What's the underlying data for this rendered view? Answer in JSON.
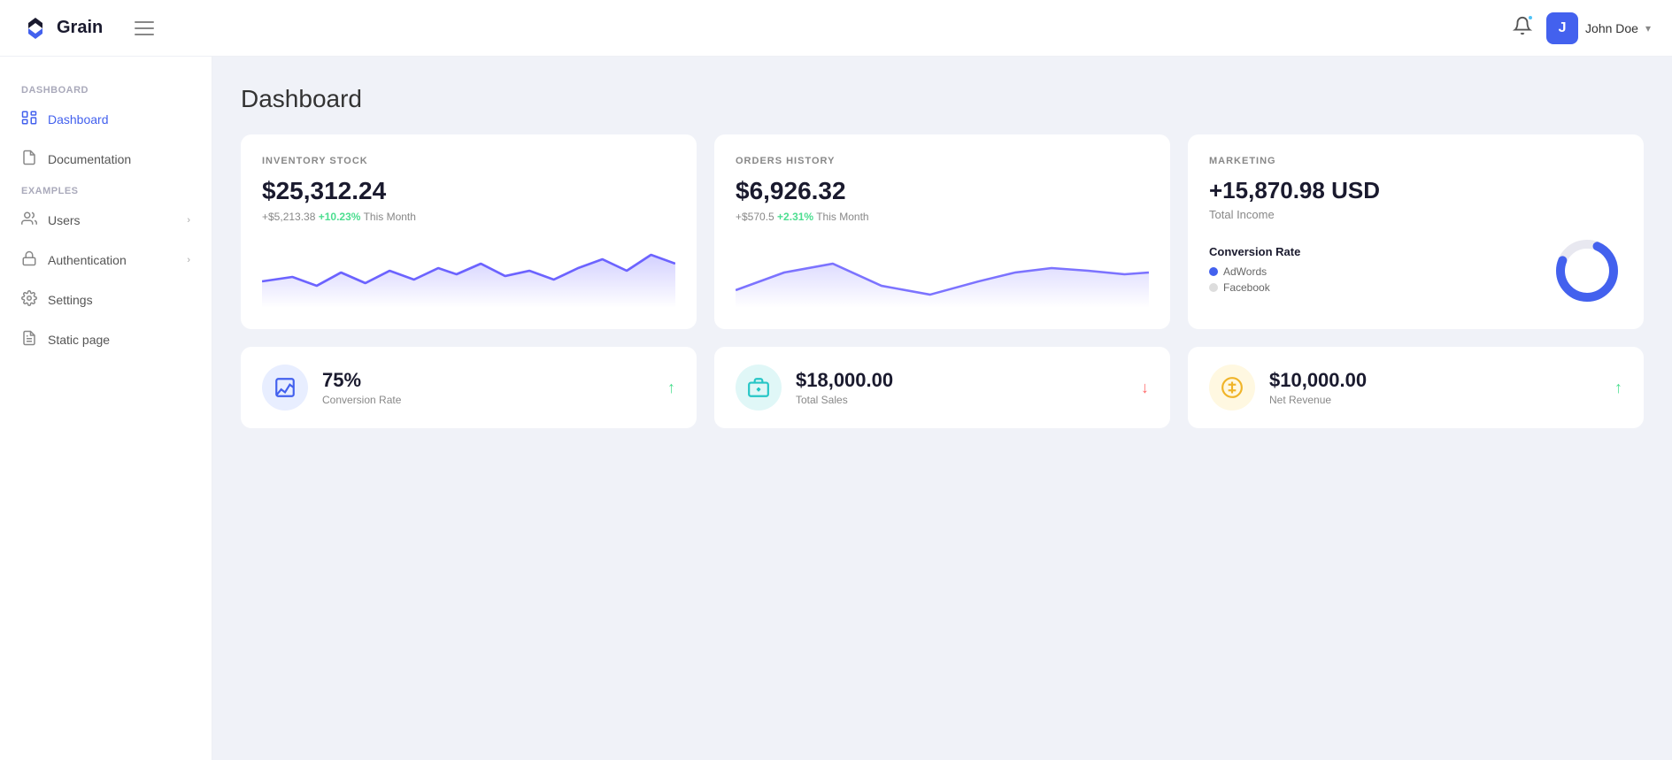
{
  "header": {
    "logo_text": "Grain",
    "hamburger_label": "Menu",
    "notification_label": "Notifications",
    "user_avatar_letter": "J",
    "user_name": "John Doe",
    "chevron": "▾"
  },
  "sidebar": {
    "sections": [
      {
        "label": "Dashboard",
        "items": [
          {
            "id": "dashboard",
            "label": "Dashboard",
            "icon": "dashboard-icon",
            "active": true,
            "hasChevron": false
          }
        ]
      },
      {
        "label": "",
        "items": [
          {
            "id": "documentation",
            "label": "Documentation",
            "icon": "doc-icon",
            "active": false,
            "hasChevron": false
          }
        ]
      },
      {
        "label": "Examples",
        "items": [
          {
            "id": "users",
            "label": "Users",
            "icon": "users-icon",
            "active": false,
            "hasChevron": true
          },
          {
            "id": "authentication",
            "label": "Authentication",
            "icon": "lock-icon",
            "active": false,
            "hasChevron": true
          },
          {
            "id": "settings",
            "label": "Settings",
            "icon": "gear-icon",
            "active": false,
            "hasChevron": false
          },
          {
            "id": "static-page",
            "label": "Static page",
            "icon": "page-icon",
            "active": false,
            "hasChevron": false
          }
        ]
      }
    ]
  },
  "main": {
    "page_title": "Dashboard",
    "top_cards": [
      {
        "id": "inventory",
        "label": "INVENTORY STOCK",
        "value": "$25,312.24",
        "sub_amount": "+$5,213.38",
        "sub_percent": "+10.23%",
        "sub_text": " This Month"
      },
      {
        "id": "orders",
        "label": "ORDERS HISTORY",
        "value": "$6,926.32",
        "sub_amount": "+$570.5",
        "sub_percent": "+2.31%",
        "sub_text": " This Month"
      },
      {
        "id": "marketing",
        "label": "MARKETING",
        "value": "+15,870.98 USD",
        "sub": "Total Income",
        "conversion_title": "Conversion Rate",
        "legend": [
          {
            "label": "AdWords",
            "color": "blue"
          },
          {
            "label": "Facebook",
            "color": "gray"
          }
        ],
        "donut_percent": 75
      }
    ],
    "bottom_cards": [
      {
        "id": "conversion-rate",
        "icon": "chart-icon",
        "icon_color": "blue",
        "value": "75%",
        "label": "Conversion Rate",
        "arrow": "up"
      },
      {
        "id": "total-sales",
        "icon": "wallet-icon",
        "icon_color": "teal",
        "value": "$18,000.00",
        "label": "Total Sales",
        "arrow": "down"
      },
      {
        "id": "net-revenue",
        "icon": "dollar-icon",
        "icon_color": "yellow",
        "value": "$10,000.00",
        "label": "Net Revenue",
        "arrow": "up"
      }
    ]
  }
}
